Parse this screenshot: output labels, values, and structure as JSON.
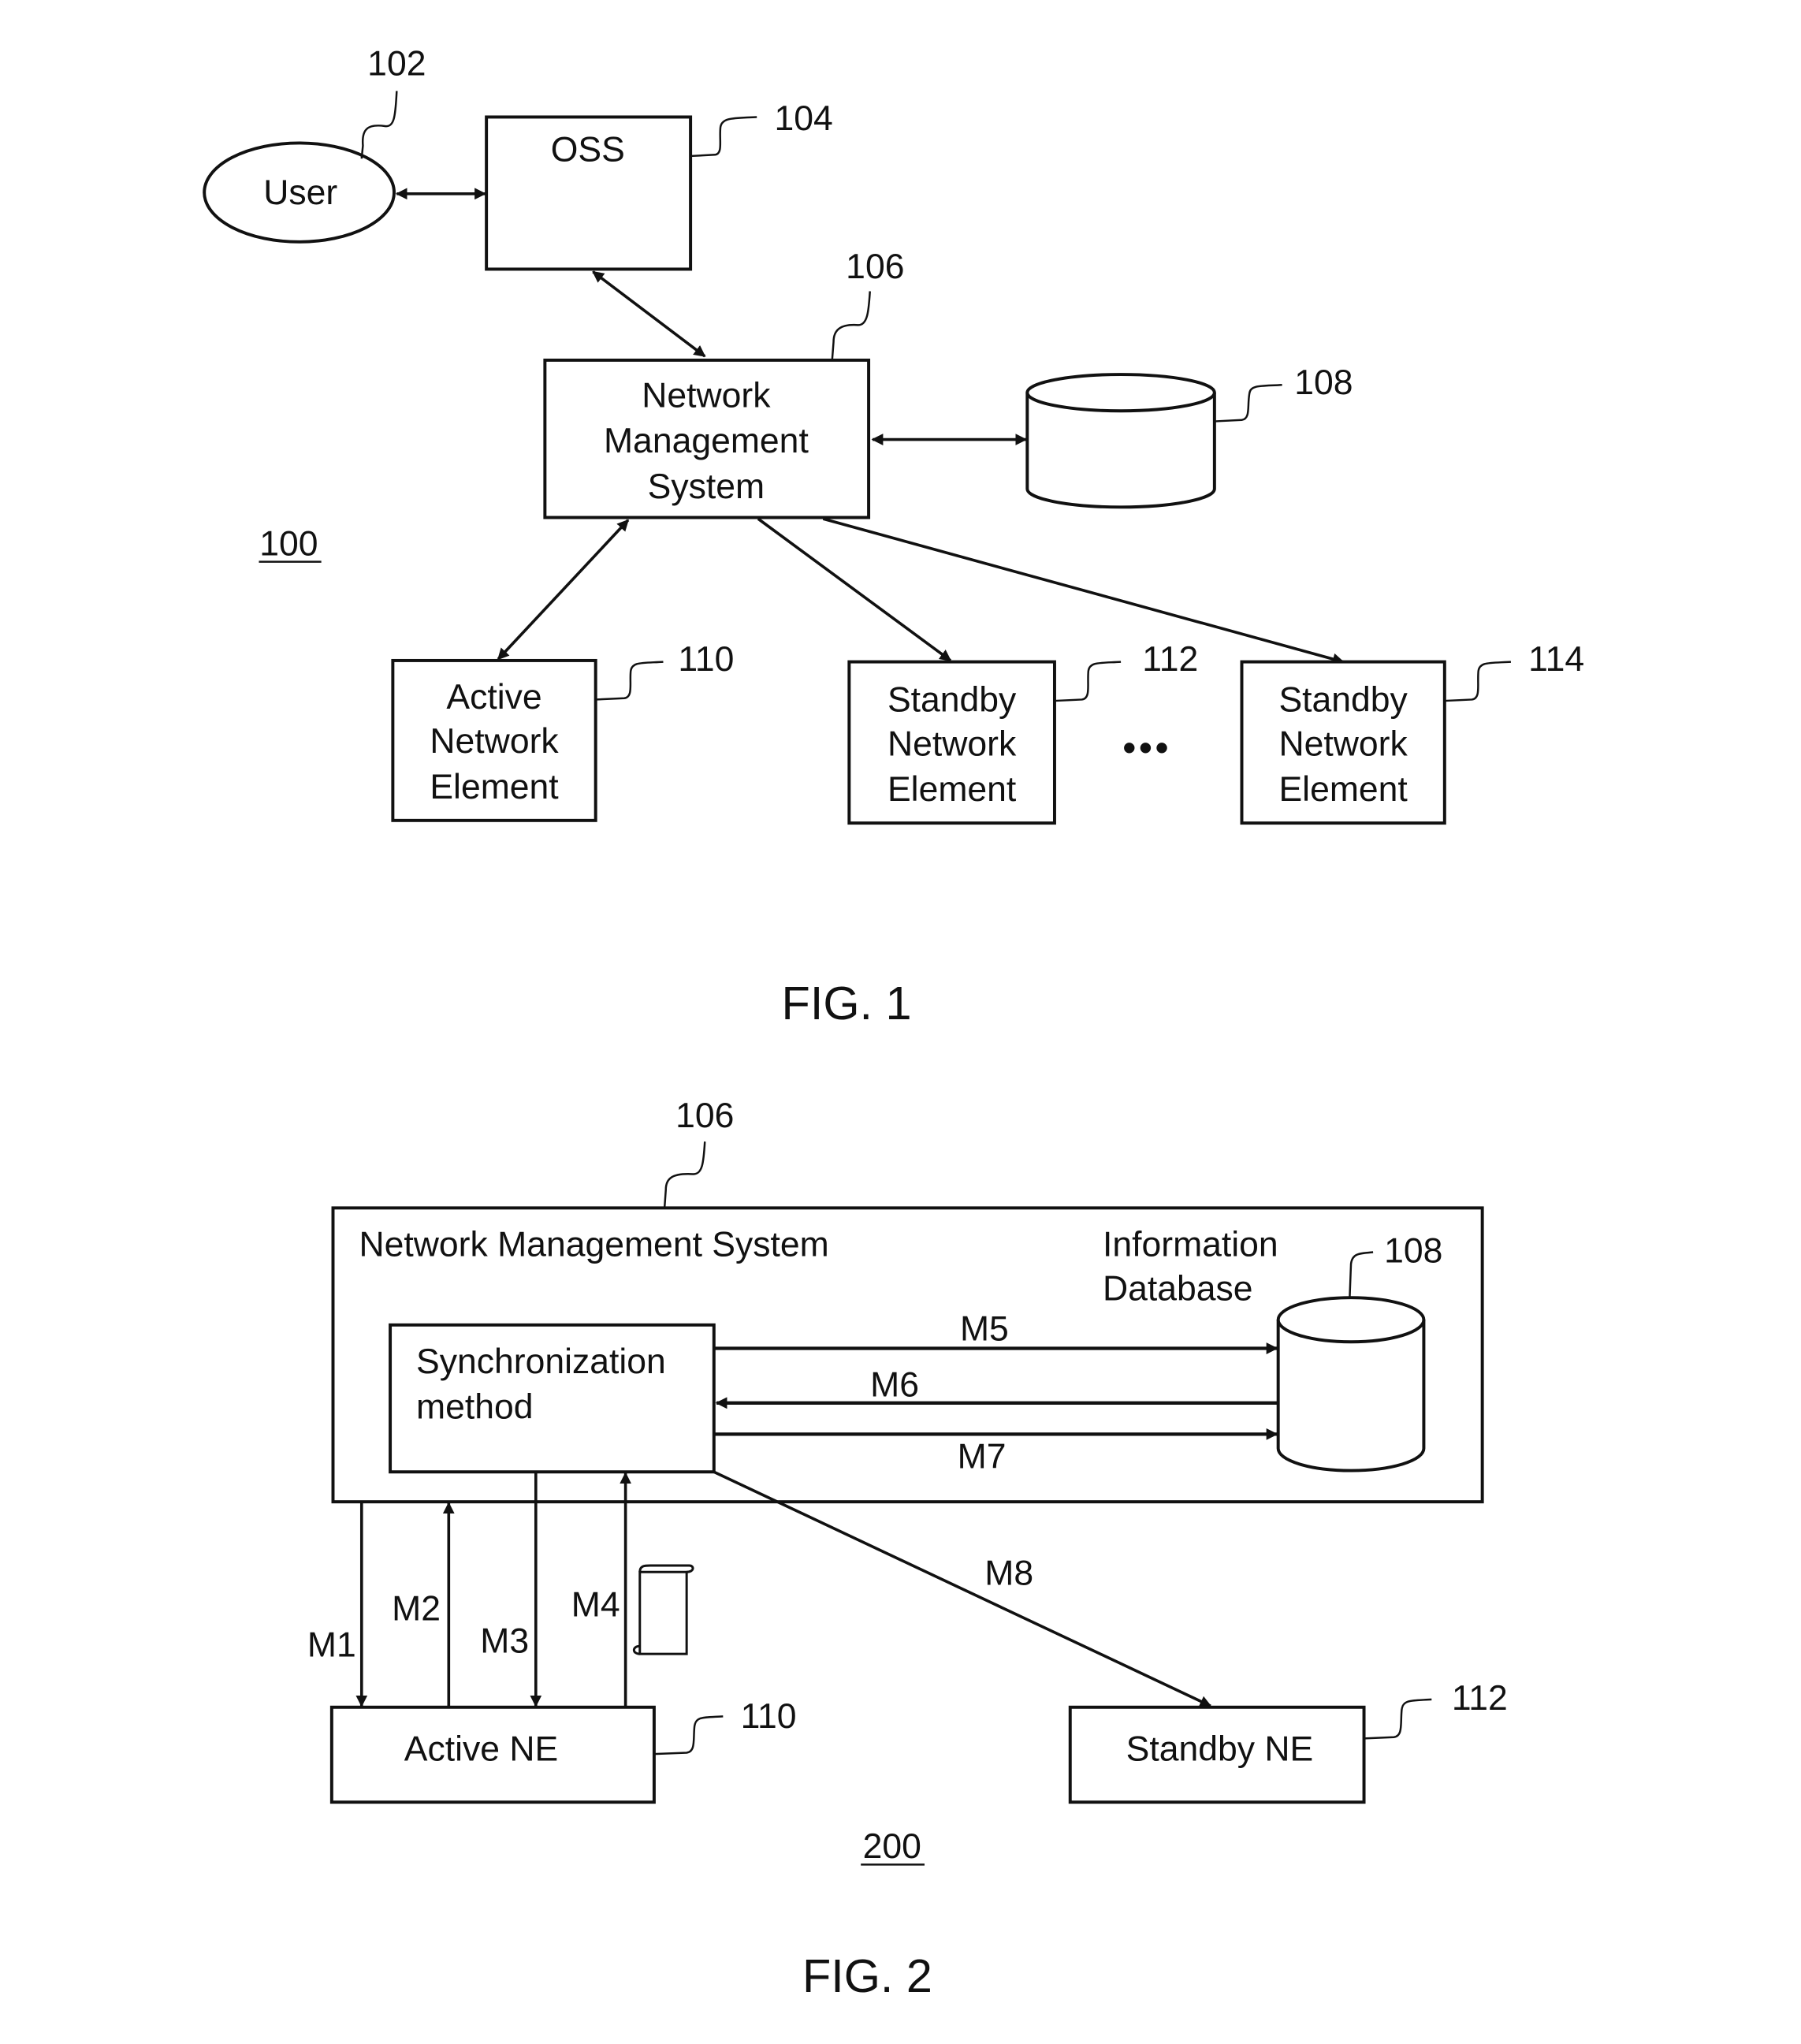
{
  "fig1": {
    "caption": "FIG. 1",
    "system_ref": "100",
    "user": {
      "label": "User",
      "ref": "102"
    },
    "oss": {
      "label": "OSS",
      "ref": "104"
    },
    "nms": {
      "lines": [
        "Network",
        "Management",
        "System"
      ],
      "ref": "106"
    },
    "database": {
      "ref": "108"
    },
    "active_ne": {
      "lines": [
        "Active",
        "Network",
        "Element"
      ],
      "ref": "110"
    },
    "standby_ne_1": {
      "lines": [
        "Standby",
        "Network",
        "Element"
      ],
      "ref": "112"
    },
    "standby_ne_2": {
      "lines": [
        "Standby",
        "Network",
        "Element"
      ],
      "ref": "114"
    },
    "ellipsis": "•••"
  },
  "fig2": {
    "caption": "FIG. 2",
    "system_ref": "200",
    "nms": {
      "label": "Network Management System",
      "ref": "106"
    },
    "database": {
      "lines": [
        "Information",
        "Database"
      ],
      "ref": "108"
    },
    "sync": {
      "lines": [
        "Synchronization",
        "method"
      ]
    },
    "active_ne": {
      "label": "Active NE",
      "ref": "110"
    },
    "standby_ne": {
      "label": "Standby NE",
      "ref": "112"
    },
    "messages": {
      "m1": "M1",
      "m2": "M2",
      "m3": "M3",
      "m4": "M4",
      "m5": "M5",
      "m6": "M6",
      "m7": "M7",
      "m8": "M8"
    }
  }
}
